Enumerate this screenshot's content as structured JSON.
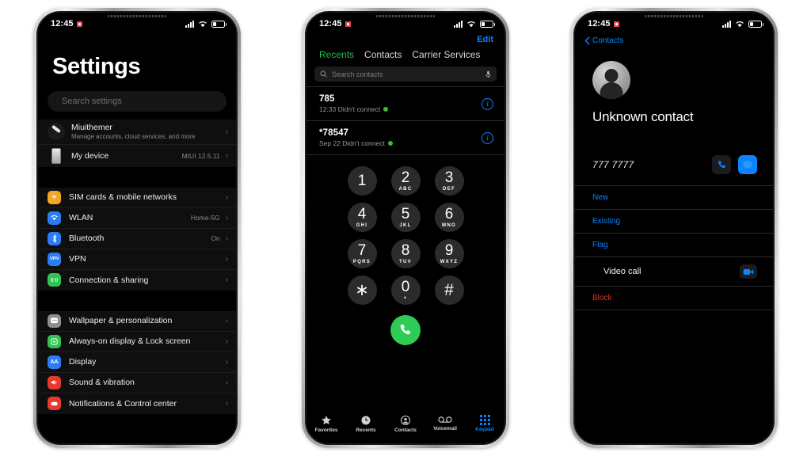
{
  "statusbar": {
    "time": "12:45",
    "rec_icon": "record-indicator-icon",
    "signal_icon": "signal-bars-icon",
    "wifi_icon": "wifi-icon",
    "battery_icon": "battery-icon"
  },
  "phone1": {
    "app": "Settings",
    "title": "Settings",
    "search_placeholder": "Search settings",
    "group1": [
      {
        "label": "Miuithemer",
        "sub": "Manage accounts, cloud services, and more",
        "value": "",
        "icon": "account-avatar-icon",
        "chevron": "›"
      },
      {
        "label": "My device",
        "sub": "",
        "value": "MIUI 12.5.11",
        "icon": "device-icon",
        "chevron": "›"
      }
    ],
    "group2": [
      {
        "label": "SIM cards & mobile networks",
        "value": "",
        "icon": "sim-card-icon",
        "glyph": "✈",
        "color": "#f5a623",
        "chevron": "›"
      },
      {
        "label": "WLAN",
        "value": "Home-5G",
        "icon": "wifi-settings-icon",
        "glyph": "◴",
        "color": "#2a7df5",
        "chevron": "›"
      },
      {
        "label": "Bluetooth",
        "value": "On",
        "icon": "bluetooth-icon",
        "glyph": "ᛦ",
        "color": "#2a7df5",
        "chevron": "›"
      },
      {
        "label": "VPN",
        "value": "",
        "icon": "vpn-icon",
        "glyph": "VPN",
        "color": "#2a7df5",
        "chevron": "›"
      },
      {
        "label": "Connection & sharing",
        "value": "",
        "icon": "connection-sharing-icon",
        "glyph": "((·))",
        "color": "#31c354",
        "chevron": "›"
      }
    ],
    "group3": [
      {
        "label": "Wallpaper & personalization",
        "value": "",
        "icon": "wallpaper-icon",
        "glyph": "■",
        "color": "#8e8e93",
        "chevron": "›"
      },
      {
        "label": "Always-on display & Lock screen",
        "value": "",
        "icon": "always-on-display-icon",
        "glyph": "❖",
        "color": "#31c354",
        "chevron": "›"
      },
      {
        "label": "Display",
        "value": "",
        "icon": "display-icon",
        "glyph": "AA",
        "color": "#2a7df5",
        "chevron": "›"
      },
      {
        "label": "Sound & vibration",
        "value": "",
        "icon": "sound-vibration-icon",
        "glyph": "◂))",
        "color": "#e8392e",
        "chevron": "›"
      },
      {
        "label": "Notifications & Control center",
        "value": "",
        "icon": "notifications-icon",
        "glyph": "▬",
        "color": "#e8392e",
        "chevron": "›"
      }
    ]
  },
  "phone2": {
    "app": "Phone",
    "edit_label": "Edit",
    "tabs": [
      {
        "label": "Recents",
        "active": true
      },
      {
        "label": "Contacts",
        "active": false
      },
      {
        "label": "Carrier Services",
        "active": false
      }
    ],
    "search_placeholder": "Search contacts",
    "search_icon": "search-icon",
    "mic_icon": "microphone-icon",
    "calls": [
      {
        "number": "785",
        "meta": "12:33 Didn't connect",
        "sim_icon": "sim-indicator-icon",
        "info_icon": "info-icon"
      },
      {
        "number": "*78547",
        "meta": "Sep 22 Didn't connect",
        "sim_icon": "sim-indicator-icon",
        "info_icon": "info-icon"
      }
    ],
    "dialpad": [
      {
        "digit": "1",
        "letters": ""
      },
      {
        "digit": "2",
        "letters": "ABC"
      },
      {
        "digit": "3",
        "letters": "DEF"
      },
      {
        "digit": "4",
        "letters": "GHI"
      },
      {
        "digit": "5",
        "letters": "JKL"
      },
      {
        "digit": "6",
        "letters": "MNO"
      },
      {
        "digit": "7",
        "letters": "PQRS"
      },
      {
        "digit": "8",
        "letters": "TUV"
      },
      {
        "digit": "9",
        "letters": "WXYZ"
      },
      {
        "digit": "∗",
        "letters": ""
      },
      {
        "digit": "0",
        "letters": "+"
      },
      {
        "digit": "#",
        "letters": ""
      }
    ],
    "call_button_icon": "call-handset-icon",
    "call_button_color": "#2ecc56",
    "tabbar": [
      {
        "label": "Favorites",
        "icon": "star-icon",
        "active": false
      },
      {
        "label": "Recents",
        "icon": "clock-icon",
        "active": false
      },
      {
        "label": "Contacts",
        "icon": "person-circle-icon",
        "active": false
      },
      {
        "label": "Voicemail",
        "icon": "voicemail-icon",
        "active": false
      },
      {
        "label": "Keypad",
        "icon": "keypad-icon",
        "active": true
      }
    ]
  },
  "phone3": {
    "app": "Contacts",
    "back_label": "Contacts",
    "back_icon": "chevron-left-icon",
    "avatar_icon": "unknown-person-avatar",
    "contact_name": "Unknown contact",
    "phone_number": "777 7777",
    "call_icon": "call-handset-icon",
    "message_icon": "message-bubble-icon",
    "rows": [
      {
        "label": "New",
        "style": "link"
      },
      {
        "label": "Existing",
        "style": "link"
      },
      {
        "label": "Flag",
        "style": "link"
      },
      {
        "label": "Video call",
        "style": "indent",
        "icon": "video-camera-icon"
      },
      {
        "label": "Block",
        "style": "danger"
      }
    ]
  },
  "colors": {
    "accent_blue": "#0a84ff",
    "accent_green": "#1bbf4d",
    "danger_red": "#d9342b",
    "background": "#ffffff"
  }
}
